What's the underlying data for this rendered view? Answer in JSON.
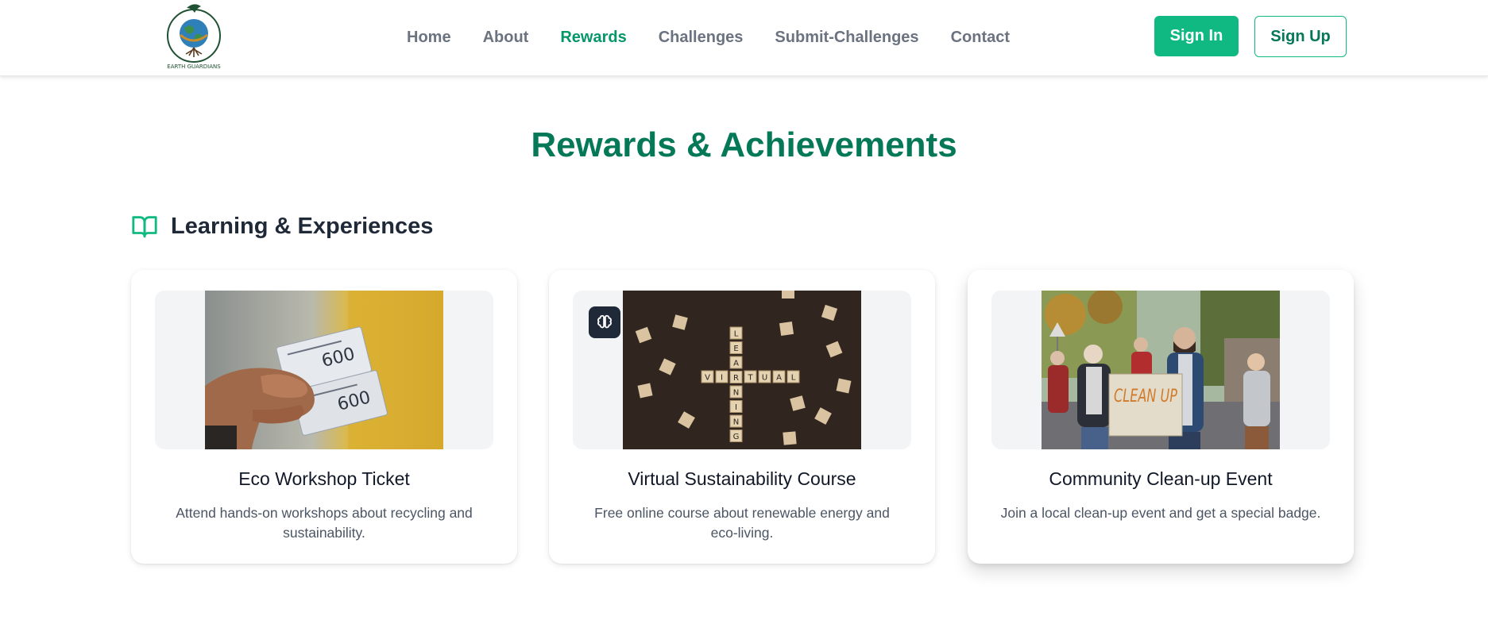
{
  "nav": {
    "logo_text": "EARTH GUARDIANS",
    "links": [
      {
        "label": "Home",
        "active": false
      },
      {
        "label": "About",
        "active": false
      },
      {
        "label": "Rewards",
        "active": true
      },
      {
        "label": "Challenges",
        "active": false
      },
      {
        "label": "Submit-Challenges",
        "active": false
      },
      {
        "label": "Contact",
        "active": false
      }
    ],
    "sign_in": "Sign In",
    "sign_up": "Sign Up"
  },
  "page": {
    "title": "Rewards & Achievements"
  },
  "section": {
    "icon": "book-open-icon",
    "title": "Learning & Experiences"
  },
  "cards": [
    {
      "title": "Eco Workshop Ticket",
      "description": "Attend hands-on workshops about recycling and sustainability.",
      "image": "hand-holding-tickets",
      "ticket_price": "600"
    },
    {
      "title": "Virtual Sustainability Course",
      "description": "Free online course about renewable energy and eco-living.",
      "image": "scrabble-tiles-virtual-learning",
      "badge_icon": "brain-icon",
      "tiles_vertical": [
        "L",
        "E",
        "A",
        "R",
        "N",
        "I",
        "N",
        "G"
      ],
      "tiles_horizontal": [
        "V",
        "I",
        "R",
        "T",
        "U",
        "A",
        "L"
      ]
    },
    {
      "title": "Community Clean-up Event",
      "description": "Join a local clean-up event and get a special badge.",
      "image": "people-cleanup-sign",
      "sign_text": "CLEAN UP"
    }
  ],
  "colors": {
    "brand": "#047857",
    "accent": "#10b981",
    "nav_text": "#6b7280"
  }
}
